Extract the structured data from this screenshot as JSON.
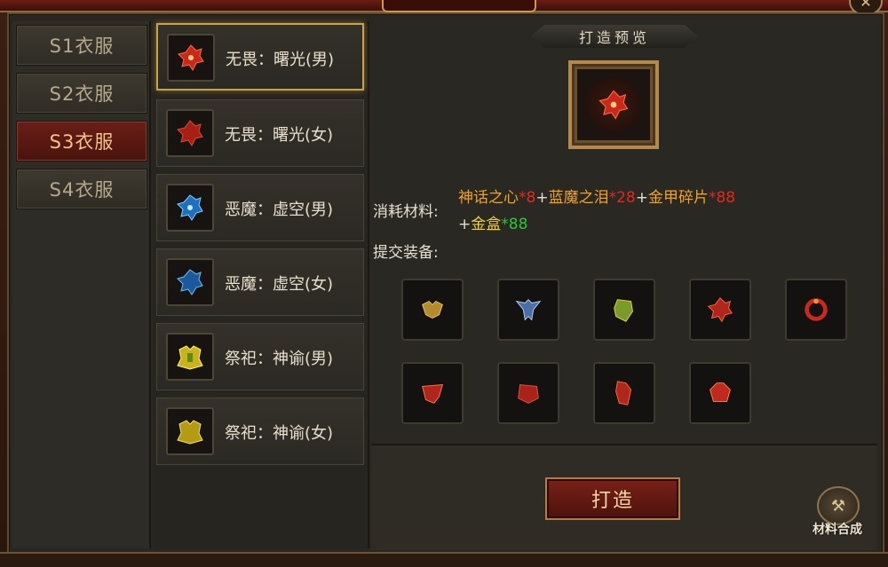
{
  "categories": [
    {
      "label": "S1衣服",
      "active": false
    },
    {
      "label": "S2衣服",
      "active": false
    },
    {
      "label": "S3衣服",
      "active": true
    },
    {
      "label": "S4衣服",
      "active": false
    }
  ],
  "items": [
    {
      "label": "无畏：曙光(男)",
      "icon": "red-armor-icon",
      "selected": true
    },
    {
      "label": "无畏：曙光(女)",
      "icon": "red-armor-icon",
      "selected": false
    },
    {
      "label": "恶魔：虚空(男)",
      "icon": "blue-armor-icon",
      "selected": false
    },
    {
      "label": "恶魔：虚空(女)",
      "icon": "blue-armor-icon",
      "selected": false
    },
    {
      "label": "祭祀：神谕(男)",
      "icon": "gold-armor-icon",
      "selected": false
    },
    {
      "label": "祭祀：神谕(女)",
      "icon": "gold-armor-icon",
      "selected": false
    }
  ],
  "preview": {
    "title": "打造预览",
    "icon": "red-armor-icon"
  },
  "materials": {
    "label": "消耗材料:",
    "list": [
      {
        "name": "神话之心",
        "qty": "*8"
      },
      {
        "name": "蓝魔之泪",
        "qty": "*28"
      },
      {
        "name": "金甲碎片",
        "qty": "*88"
      }
    ],
    "extra": {
      "name": "金盒",
      "qty": "*88"
    }
  },
  "submit": {
    "label": "提交装备:",
    "slots": [
      "gold-armor-icon",
      "blue-armor-icon",
      "green-armor-icon",
      "red-armor-icon",
      "red-ring-icon",
      "red-armor-icon",
      "red-armor-icon",
      "red-armor-icon",
      "red-armor-icon"
    ]
  },
  "actions": {
    "forge_label": "打造",
    "synth_label": "材料合成",
    "close": "✕"
  },
  "colors": {
    "accent_gold": "#c9a24e",
    "material_name": "#f4a31e",
    "material_qty": "#e12a1c",
    "gold_box": "#f1d23a",
    "gold_box_qty": "#2cc43a"
  }
}
